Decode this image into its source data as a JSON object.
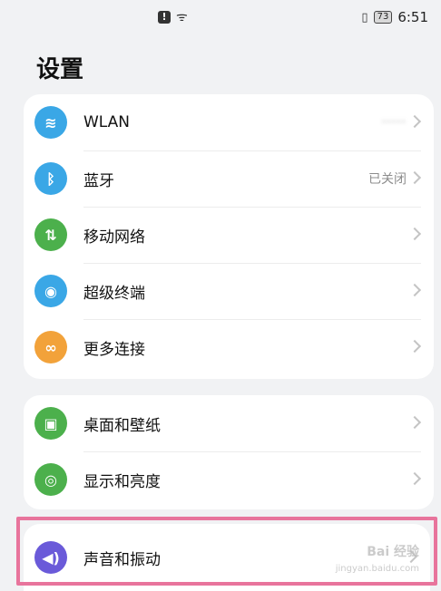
{
  "status_bar": {
    "alert_glyph": "!",
    "wifi_glyph": "ᯤ",
    "vibrate_glyph": "▯",
    "battery": "73",
    "time": "6:51"
  },
  "title": "设置",
  "groups": [
    {
      "items": [
        {
          "label": "WLAN",
          "value": "·····",
          "icon": "wifi-icon",
          "glyph": "≋",
          "color": "#3aa7e6"
        },
        {
          "label": "蓝牙",
          "value": "已关闭",
          "icon": "bluetooth-icon",
          "glyph": "ᛒ",
          "color": "#3aa7e6"
        },
        {
          "label": "移动网络",
          "value": "",
          "icon": "mobile-network-icon",
          "glyph": "⇅",
          "color": "#4cb04c"
        },
        {
          "label": "超级终端",
          "value": "",
          "icon": "super-device-icon",
          "glyph": "◉",
          "color": "#3aa7e6"
        },
        {
          "label": "更多连接",
          "value": "",
          "icon": "link-icon",
          "glyph": "∞",
          "color": "#f2a23a"
        }
      ]
    },
    {
      "items": [
        {
          "label": "桌面和壁纸",
          "value": "",
          "icon": "wallpaper-icon",
          "glyph": "▣",
          "color": "#4cb04c"
        },
        {
          "label": "显示和亮度",
          "value": "",
          "icon": "eye-icon",
          "glyph": "◎",
          "color": "#4cb04c"
        }
      ]
    },
    {
      "items": [
        {
          "label": "声音和振动",
          "value": "",
          "icon": "speaker-icon",
          "glyph": "◀)",
          "color": "#6a5ad9"
        }
      ]
    }
  ],
  "watermark": {
    "text": "Bai 经验",
    "sub": "jingyan.baidu.com"
  }
}
